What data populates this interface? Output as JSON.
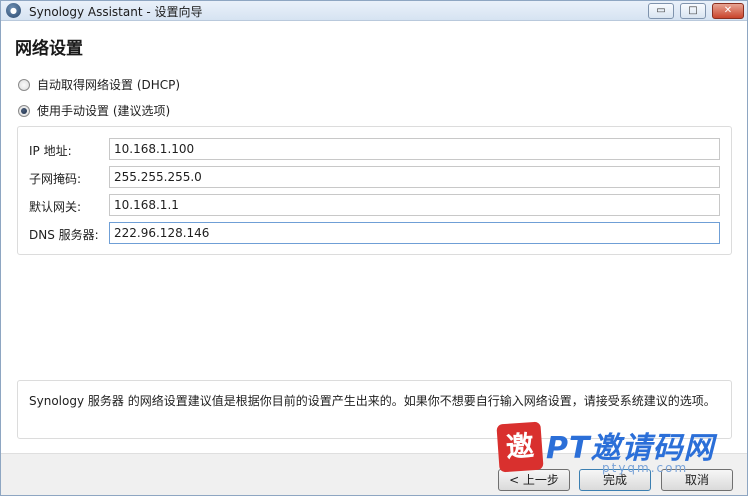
{
  "window": {
    "app_icon": "synology-icon",
    "title": "Synology Assistant  - 设置向导",
    "controls": {
      "minimize": "▭",
      "maximize": "□",
      "close": "✕"
    }
  },
  "page": {
    "heading": "网络设置"
  },
  "radios": [
    {
      "label": "自动取得网络设置 (DHCP)",
      "checked": false
    },
    {
      "label": "使用手动设置  (建议选项)",
      "checked": true
    }
  ],
  "fields": {
    "ip": {
      "label": "IP 地址:",
      "value": "10.168.1.100"
    },
    "mask": {
      "label": "子网掩码:",
      "value": "255.255.255.0"
    },
    "gateway": {
      "label": "默认网关:",
      "value": "10.168.1.1"
    },
    "dns": {
      "label": "DNS 服务器:",
      "value": "222.96.128.146"
    }
  },
  "note": "Synology 服务器 的网络设置建议值是根据你目前的设置产生出来的。如果你不想要自行输入网络设置，请接受系统建议的选项。",
  "buttons": {
    "back": "< 上一步",
    "finish": "完成",
    "cancel": "取消"
  },
  "watermark": {
    "seal": "邀",
    "text": "PT邀请码网",
    "url": "ptyqm.com"
  },
  "colors": {
    "title_bar": "#d6e3f2",
    "close_button": "#c9442c",
    "watermark_blue": "#2b6fd8",
    "watermark_red": "#d9302e"
  }
}
